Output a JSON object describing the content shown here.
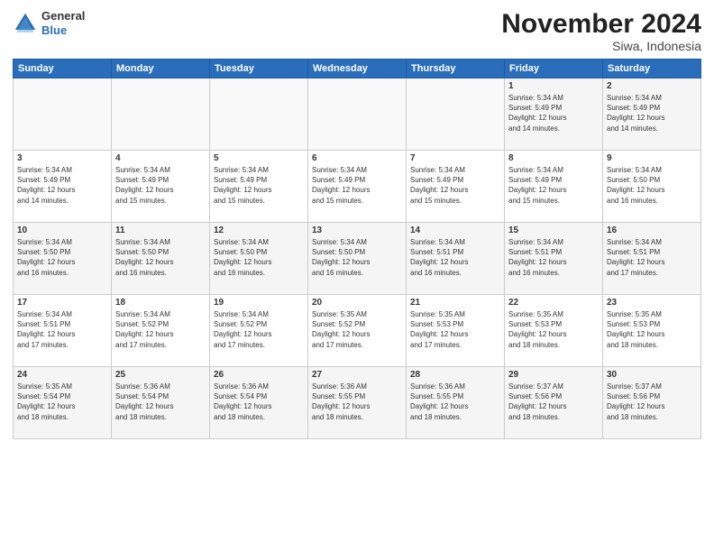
{
  "logo": {
    "general": "General",
    "blue": "Blue"
  },
  "title": "November 2024",
  "location": "Siwa, Indonesia",
  "days_of_week": [
    "Sunday",
    "Monday",
    "Tuesday",
    "Wednesday",
    "Thursday",
    "Friday",
    "Saturday"
  ],
  "weeks": [
    [
      {
        "num": "",
        "info": ""
      },
      {
        "num": "",
        "info": ""
      },
      {
        "num": "",
        "info": ""
      },
      {
        "num": "",
        "info": ""
      },
      {
        "num": "",
        "info": ""
      },
      {
        "num": "1",
        "info": "Sunrise: 5:34 AM\nSunset: 5:49 PM\nDaylight: 12 hours\nand 14 minutes."
      },
      {
        "num": "2",
        "info": "Sunrise: 5:34 AM\nSunset: 5:49 PM\nDaylight: 12 hours\nand 14 minutes."
      }
    ],
    [
      {
        "num": "3",
        "info": "Sunrise: 5:34 AM\nSunset: 5:49 PM\nDaylight: 12 hours\nand 14 minutes."
      },
      {
        "num": "4",
        "info": "Sunrise: 5:34 AM\nSunset: 5:49 PM\nDaylight: 12 hours\nand 15 minutes."
      },
      {
        "num": "5",
        "info": "Sunrise: 5:34 AM\nSunset: 5:49 PM\nDaylight: 12 hours\nand 15 minutes."
      },
      {
        "num": "6",
        "info": "Sunrise: 5:34 AM\nSunset: 5:49 PM\nDaylight: 12 hours\nand 15 minutes."
      },
      {
        "num": "7",
        "info": "Sunrise: 5:34 AM\nSunset: 5:49 PM\nDaylight: 12 hours\nand 15 minutes."
      },
      {
        "num": "8",
        "info": "Sunrise: 5:34 AM\nSunset: 5:49 PM\nDaylight: 12 hours\nand 15 minutes."
      },
      {
        "num": "9",
        "info": "Sunrise: 5:34 AM\nSunset: 5:50 PM\nDaylight: 12 hours\nand 16 minutes."
      }
    ],
    [
      {
        "num": "10",
        "info": "Sunrise: 5:34 AM\nSunset: 5:50 PM\nDaylight: 12 hours\nand 16 minutes."
      },
      {
        "num": "11",
        "info": "Sunrise: 5:34 AM\nSunset: 5:50 PM\nDaylight: 12 hours\nand 16 minutes."
      },
      {
        "num": "12",
        "info": "Sunrise: 5:34 AM\nSunset: 5:50 PM\nDaylight: 12 hours\nand 16 minutes."
      },
      {
        "num": "13",
        "info": "Sunrise: 5:34 AM\nSunset: 5:50 PM\nDaylight: 12 hours\nand 16 minutes."
      },
      {
        "num": "14",
        "info": "Sunrise: 5:34 AM\nSunset: 5:51 PM\nDaylight: 12 hours\nand 16 minutes."
      },
      {
        "num": "15",
        "info": "Sunrise: 5:34 AM\nSunset: 5:51 PM\nDaylight: 12 hours\nand 16 minutes."
      },
      {
        "num": "16",
        "info": "Sunrise: 5:34 AM\nSunset: 5:51 PM\nDaylight: 12 hours\nand 17 minutes."
      }
    ],
    [
      {
        "num": "17",
        "info": "Sunrise: 5:34 AM\nSunset: 5:51 PM\nDaylight: 12 hours\nand 17 minutes."
      },
      {
        "num": "18",
        "info": "Sunrise: 5:34 AM\nSunset: 5:52 PM\nDaylight: 12 hours\nand 17 minutes."
      },
      {
        "num": "19",
        "info": "Sunrise: 5:34 AM\nSunset: 5:52 PM\nDaylight: 12 hours\nand 17 minutes."
      },
      {
        "num": "20",
        "info": "Sunrise: 5:35 AM\nSunset: 5:52 PM\nDaylight: 12 hours\nand 17 minutes."
      },
      {
        "num": "21",
        "info": "Sunrise: 5:35 AM\nSunset: 5:53 PM\nDaylight: 12 hours\nand 17 minutes."
      },
      {
        "num": "22",
        "info": "Sunrise: 5:35 AM\nSunset: 5:53 PM\nDaylight: 12 hours\nand 18 minutes."
      },
      {
        "num": "23",
        "info": "Sunrise: 5:35 AM\nSunset: 5:53 PM\nDaylight: 12 hours\nand 18 minutes."
      }
    ],
    [
      {
        "num": "24",
        "info": "Sunrise: 5:35 AM\nSunset: 5:54 PM\nDaylight: 12 hours\nand 18 minutes."
      },
      {
        "num": "25",
        "info": "Sunrise: 5:36 AM\nSunset: 5:54 PM\nDaylight: 12 hours\nand 18 minutes."
      },
      {
        "num": "26",
        "info": "Sunrise: 5:36 AM\nSunset: 5:54 PM\nDaylight: 12 hours\nand 18 minutes."
      },
      {
        "num": "27",
        "info": "Sunrise: 5:36 AM\nSunset: 5:55 PM\nDaylight: 12 hours\nand 18 minutes."
      },
      {
        "num": "28",
        "info": "Sunrise: 5:36 AM\nSunset: 5:55 PM\nDaylight: 12 hours\nand 18 minutes."
      },
      {
        "num": "29",
        "info": "Sunrise: 5:37 AM\nSunset: 5:56 PM\nDaylight: 12 hours\nand 18 minutes."
      },
      {
        "num": "30",
        "info": "Sunrise: 5:37 AM\nSunset: 5:56 PM\nDaylight: 12 hours\nand 18 minutes."
      }
    ]
  ]
}
